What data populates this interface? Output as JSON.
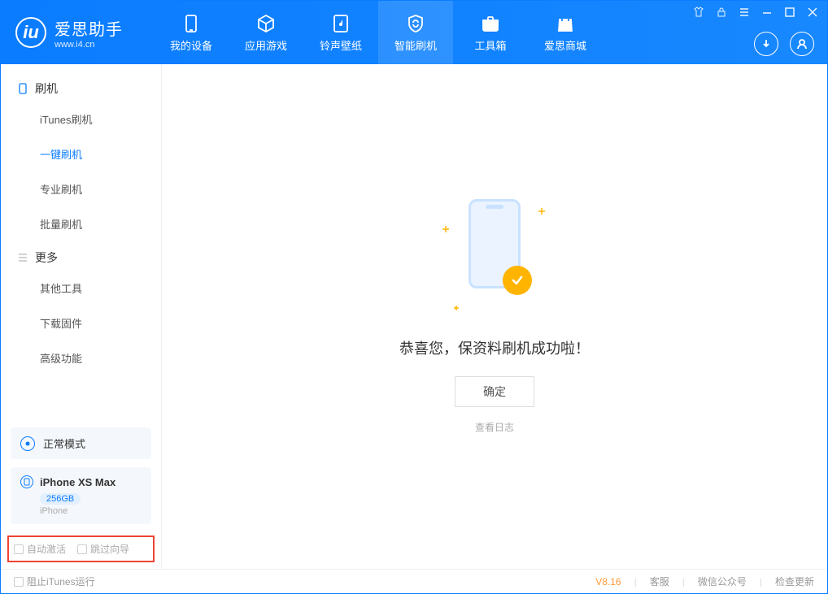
{
  "brand": {
    "name": "爱思助手",
    "url": "www.i4.cn"
  },
  "nav": {
    "items": [
      {
        "label": "我的设备"
      },
      {
        "label": "应用游戏"
      },
      {
        "label": "铃声壁纸"
      },
      {
        "label": "智能刷机"
      },
      {
        "label": "工具箱"
      },
      {
        "label": "爱思商城"
      }
    ],
    "active_index": 3
  },
  "sidebar": {
    "group1": {
      "title": "刷机",
      "items": [
        "iTunes刷机",
        "一键刷机",
        "专业刷机",
        "批量刷机"
      ],
      "selected_index": 1
    },
    "group2": {
      "title": "更多",
      "items": [
        "其他工具",
        "下载固件",
        "高级功能"
      ]
    },
    "mode": "正常模式",
    "device": {
      "name": "iPhone XS Max",
      "capacity": "256GB",
      "type": "iPhone"
    },
    "checks": {
      "auto_activate": "自动激活",
      "skip_guide": "跳过向导"
    }
  },
  "main": {
    "success": "恭喜您，保资料刷机成功啦！",
    "ok": "确定",
    "log": "查看日志"
  },
  "footer": {
    "block_itunes": "阻止iTunes运行",
    "version": "V8.16",
    "links": [
      "客服",
      "微信公众号",
      "检查更新"
    ]
  }
}
